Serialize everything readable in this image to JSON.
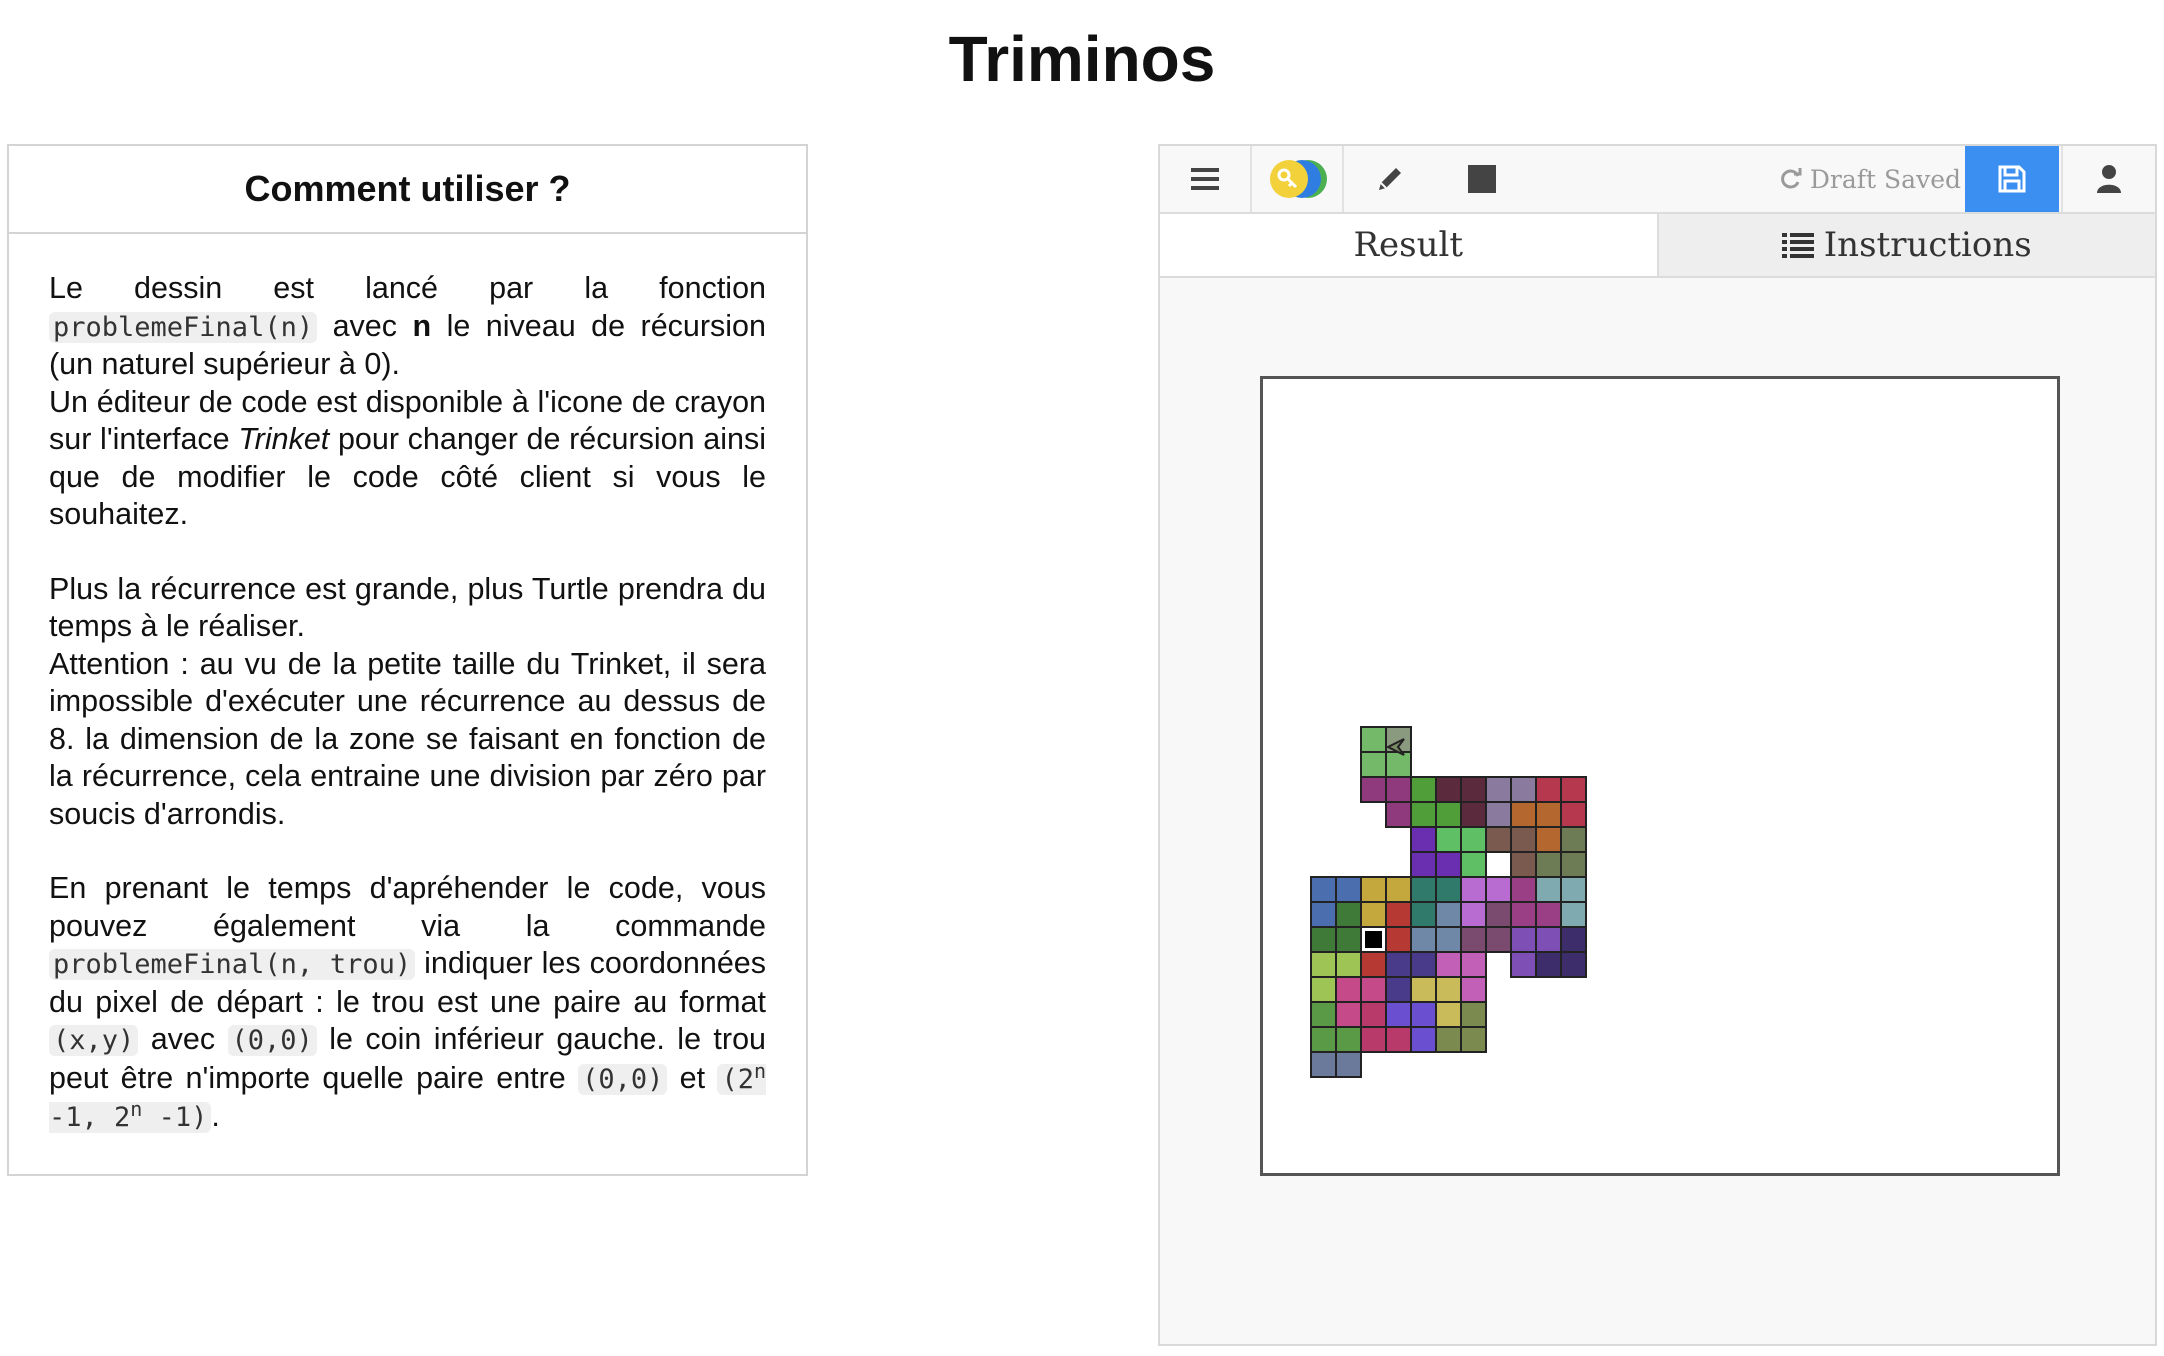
{
  "page": {
    "title": "Triminos"
  },
  "help": {
    "heading": "Comment utiliser ?",
    "p1": {
      "t1": "Le dessin est lancé par la fonction ",
      "code1": "problemeFinal(n)",
      "t2": " avec ",
      "bold": "n",
      "t3": " le niveau de récursion (un naturel supérieur à 0)."
    },
    "p2": {
      "t1": "Un éditeur de code est disponible à l'icone de crayon sur l'interface ",
      "em": "Trinket",
      "t2": " pour changer de récursion ainsi que de modifier le code côté client si vous le souhaitez."
    },
    "p3": "Plus la récurrence est grande, plus Turtle prendra du temps à le réaliser.",
    "p4": "Attention : au vu de la petite taille du Trinket, il sera impossible d'exécuter une récurrence au dessus de 8. la dimension de la zone se faisant en fonction de la récurrence, cela entraine une division par zéro par soucis d'arrondis.",
    "p5": {
      "t1": "En prenant le temps d'apréhender le code, vous pouvez également via la commande ",
      "code1": "problemeFinal(n,  trou)",
      "t2": " indiquer les coordonnées du pixel de départ : le trou est une paire au format ",
      "code2": "(x,y)",
      "t3": " avec ",
      "code3": "(0,0)",
      "t4": " le coin inférieur gauche. le trou peut être n'importe quelle paire entre ",
      "code4": "(0,0)",
      "t5": " et ",
      "code5a": "(2",
      "sup1": "n",
      "code5b": " -1, 2",
      "sup2": "n",
      "code5c": " -1)",
      "t6": "."
    }
  },
  "trinket": {
    "toolbar": {
      "menu_icon": "hamburger-icon",
      "toggle_icon": "key-toggle-icon",
      "edit_icon": "pencil-icon",
      "stop_icon": "stop-square-icon",
      "draft_status": "Draft Saved",
      "save_icon": "floppy-disk-icon",
      "user_icon": "user-icon",
      "save_color": "#3b8ff0"
    },
    "tabs": {
      "result": "Result",
      "instructions": "Instructions"
    }
  },
  "drawing": {
    "grid": [
      "........................................",
      "........................................",
      "........................................",
      "........................................",
      "........................................",
      "........................................",
      "........................................",
      "........................................",
      "........................................",
      "........................................",
      "........................................",
      "........................................",
      "........................................",
      "........................................",
      "........................................",
      "........................................",
      "........................................",
      "........................................",
      "........................................",
      "........................................",
      "........................................",
      "........................................",
      "........................................",
      "........................................",
      "........................................",
      "........................................",
      "........................................",
      "........................................",
      "........................................",
      "........................................",
      "........................................",
      "........................................",
      "........................................",
      "........................................",
      "........................................",
      "........................................",
      "........................................",
      "........................................",
      "........................................",
      "........................................"
    ],
    "pieces": [
      {
        "cells": [
          [
            2,
            18
          ],
          [
            2,
            19
          ],
          [
            3,
            19
          ]
        ],
        "color": "#74b96a"
      },
      {
        "cells": [
          [
            3,
            18
          ]
        ],
        "color": "#8a9a7e"
      },
      {
        "cells": [
          [
            2,
            20
          ],
          [
            3,
            20
          ],
          [
            3,
            21
          ]
        ],
        "color": "#8e3a7c"
      },
      {
        "cells": [
          [
            4,
            20
          ],
          [
            4,
            21
          ],
          [
            5,
            21
          ]
        ],
        "color": "#4f9e3a"
      },
      {
        "cells": [
          [
            5,
            20
          ],
          [
            6,
            20
          ],
          [
            6,
            21
          ]
        ],
        "color": "#5c2a3d"
      },
      {
        "cells": [
          [
            7,
            20
          ],
          [
            8,
            20
          ],
          [
            7,
            21
          ]
        ],
        "color": "#8a7a9e"
      },
      {
        "cells": [
          [
            9,
            20
          ],
          [
            10,
            20
          ],
          [
            10,
            21
          ]
        ],
        "color": "#b5384f"
      },
      {
        "cells": [
          [
            8,
            21
          ],
          [
            9,
            21
          ],
          [
            9,
            22
          ]
        ],
        "color": "#b4672e"
      },
      {
        "cells": [
          [
            10,
            22
          ],
          [
            10,
            23
          ],
          [
            9,
            23
          ]
        ],
        "color": "#6d7c55"
      },
      {
        "cells": [
          [
            7,
            22
          ],
          [
            8,
            22
          ],
          [
            8,
            23
          ]
        ],
        "color": "#7a5a4e"
      },
      {
        "cells": [
          [
            5,
            22
          ],
          [
            6,
            22
          ],
          [
            6,
            23
          ]
        ],
        "color": "#5fbf64"
      },
      {
        "cells": [
          [
            4,
            22
          ],
          [
            4,
            23
          ],
          [
            5,
            23
          ]
        ],
        "color": "#6a2fb0"
      },
      {
        "cells": [
          [
            0,
            24
          ],
          [
            0,
            25
          ],
          [
            1,
            24
          ]
        ],
        "color": "#4b6fae"
      },
      {
        "cells": [
          [
            2,
            24
          ],
          [
            3,
            24
          ],
          [
            2,
            25
          ]
        ],
        "color": "#c4a83e"
      },
      {
        "cells": [
          [
            4,
            24
          ],
          [
            5,
            24
          ],
          [
            4,
            25
          ]
        ],
        "color": "#2f7a6a"
      },
      {
        "cells": [
          [
            6,
            24
          ],
          [
            7,
            24
          ],
          [
            6,
            25
          ]
        ],
        "color": "#b86bd0"
      },
      {
        "cells": [
          [
            7,
            25
          ],
          [
            7,
            26
          ],
          [
            6,
            26
          ]
        ],
        "color": "#7b4b6f"
      },
      {
        "cells": [
          [
            8,
            24
          ],
          [
            8,
            25
          ],
          [
            9,
            25
          ]
        ],
        "color": "#9a3f86"
      },
      {
        "cells": [
          [
            9,
            24
          ],
          [
            10,
            24
          ],
          [
            10,
            25
          ]
        ],
        "color": "#7faab0"
      },
      {
        "cells": [
          [
            1,
            25
          ],
          [
            1,
            26
          ],
          [
            0,
            26
          ]
        ],
        "color": "#3f7a38"
      },
      {
        "cells": [
          [
            5,
            25
          ],
          [
            5,
            26
          ],
          [
            4,
            26
          ]
        ],
        "color": "#6f88a8"
      },
      {
        "cells": [
          [
            3,
            25
          ],
          [
            3,
            26
          ],
          [
            2,
            27
          ]
        ],
        "color": "#b63a33"
      },
      {
        "cells": [
          [
            8,
            26
          ],
          [
            9,
            26
          ],
          [
            8,
            27
          ]
        ],
        "color": "#7e4fb4"
      },
      {
        "cells": [
          [
            10,
            26
          ],
          [
            10,
            27
          ],
          [
            9,
            27
          ]
        ],
        "color": "#3d2d6a"
      },
      {
        "cells": [
          [
            0,
            27
          ],
          [
            1,
            27
          ],
          [
            0,
            28
          ]
        ],
        "color": "#9ec456"
      },
      {
        "cells": [
          [
            3,
            27
          ],
          [
            4,
            27
          ],
          [
            3,
            28
          ]
        ],
        "color": "#4a3a8a"
      },
      {
        "cells": [
          [
            5,
            27
          ],
          [
            6,
            27
          ],
          [
            6,
            28
          ]
        ],
        "color": "#c25fb6"
      },
      {
        "cells": [
          [
            2,
            28
          ],
          [
            1,
            28
          ],
          [
            1,
            29
          ]
        ],
        "color": "#c44a8a"
      },
      {
        "cells": [
          [
            4,
            28
          ],
          [
            5,
            28
          ],
          [
            5,
            29
          ]
        ],
        "color": "#c9bb5a"
      },
      {
        "cells": [
          [
            0,
            29
          ],
          [
            0,
            30
          ],
          [
            1,
            30
          ]
        ],
        "color": "#5a9a46"
      },
      {
        "cells": [
          [
            2,
            29
          ],
          [
            2,
            30
          ],
          [
            3,
            30
          ]
        ],
        "color": "#b83a6a"
      },
      {
        "cells": [
          [
            3,
            29
          ],
          [
            4,
            29
          ],
          [
            4,
            30
          ]
        ],
        "color": "#6a4fd0"
      },
      {
        "cells": [
          [
            5,
            30
          ],
          [
            6,
            30
          ],
          [
            6,
            29
          ]
        ],
        "color": "#7b8a4f"
      },
      {
        "cells": [
          [
            1,
            31
          ],
          [
            0,
            31
          ]
        ],
        "color": "#6b7a9a"
      }
    ],
    "hole": [
      2,
      26
    ],
    "colors": {
      "frame": "#555555",
      "hole": "#000000"
    }
  }
}
